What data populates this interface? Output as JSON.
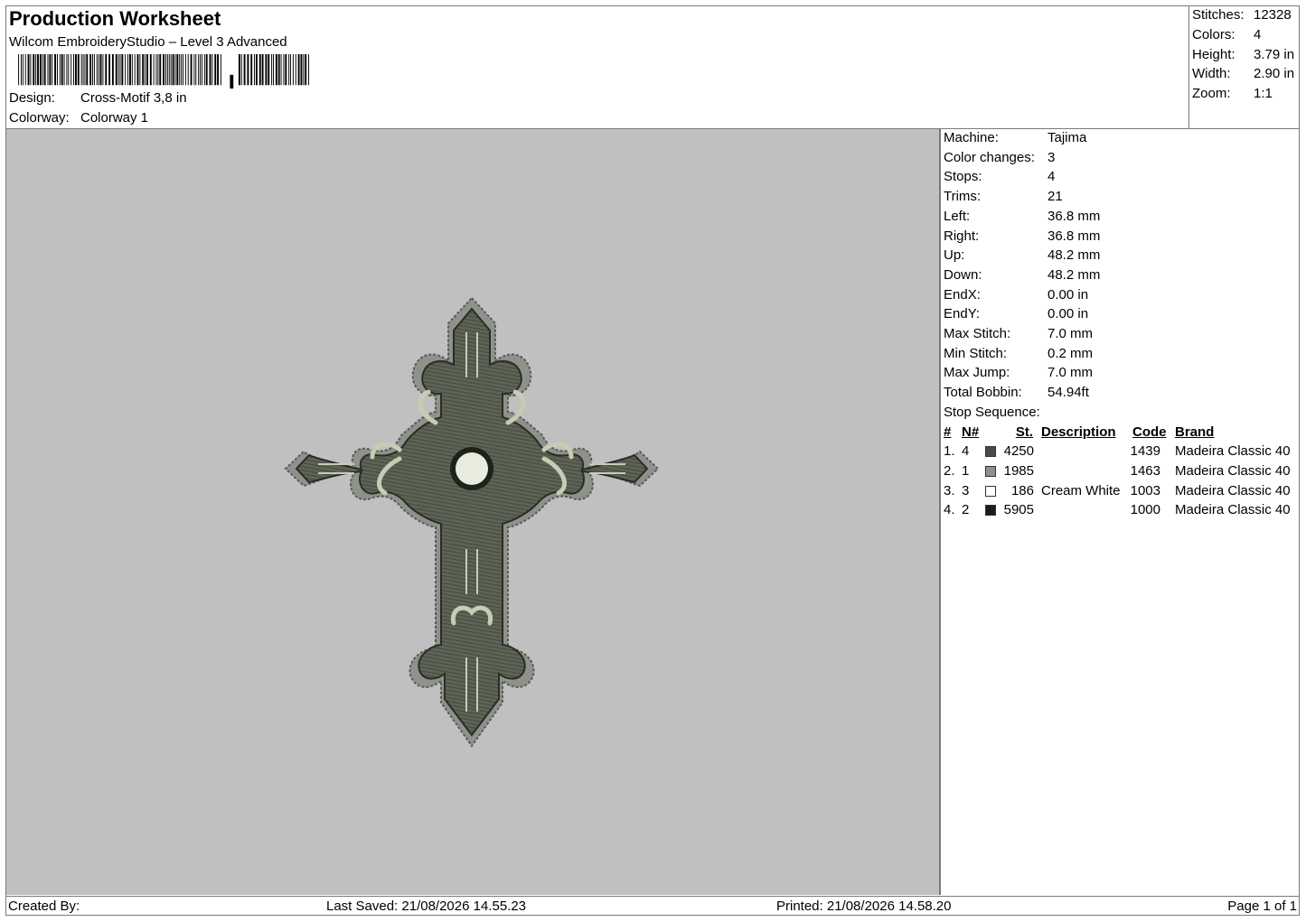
{
  "header": {
    "title": "Production Worksheet",
    "software": "Wilcom EmbroideryStudio – Level 3 Advanced",
    "design_label": "Design:",
    "design_value": "Cross-Motif 3,8 in",
    "colorway_label": "Colorway:",
    "colorway_value": "Colorway 1"
  },
  "stats": {
    "stitches_label": "Stitches:",
    "stitches_value": "12328",
    "colors_label": "Colors:",
    "colors_value": "4",
    "height_label": "Height:",
    "height_value": "3.79 in",
    "width_label": "Width:",
    "width_value": "2.90 in",
    "zoom_label": "Zoom:",
    "zoom_value": "1:1"
  },
  "machine_info": [
    {
      "label": "Machine:",
      "value": "Tajima"
    },
    {
      "label": "Color changes:",
      "value": "3"
    },
    {
      "label": "Stops:",
      "value": "4"
    },
    {
      "label": "Trims:",
      "value": "21"
    },
    {
      "label": "Left:",
      "value": "36.8 mm"
    },
    {
      "label": "Right:",
      "value": "36.8 mm"
    },
    {
      "label": "Up:",
      "value": "48.2 mm"
    },
    {
      "label": "Down:",
      "value": "48.2 mm"
    },
    {
      "label": "EndX:",
      "value": "0.00 in"
    },
    {
      "label": "EndY:",
      "value": "0.00 in"
    },
    {
      "label": "Max Stitch:",
      "value": "7.0 mm"
    },
    {
      "label": "Min Stitch:",
      "value": "0.2 mm"
    },
    {
      "label": "Max Jump:",
      "value": "7.0 mm"
    },
    {
      "label": "Total Bobbin:",
      "value": "54.94ft"
    }
  ],
  "stop_sequence_label": "Stop Sequence:",
  "table": {
    "headers": {
      "idx": "#",
      "n": "N#",
      "st": "St.",
      "desc": "Description",
      "code": "Code",
      "brand": "Brand"
    },
    "rows": [
      {
        "idx": "1.",
        "n": "4",
        "color": "#4a4a4a",
        "st": "4250",
        "desc": "",
        "code": "1439",
        "brand": "Madeira Classic 40"
      },
      {
        "idx": "2.",
        "n": "1",
        "color": "#8f9188",
        "st": "1985",
        "desc": "",
        "code": "1463",
        "brand": "Madeira Classic 40"
      },
      {
        "idx": "3.",
        "n": "3",
        "color": "#ffffff",
        "st": "186",
        "desc": "Cream White",
        "code": "1003",
        "brand": "Madeira Classic 40"
      },
      {
        "idx": "4.",
        "n": "2",
        "color": "#1c1c1c",
        "st": "5905",
        "desc": "",
        "code": "1000",
        "brand": "Madeira Classic 40"
      }
    ]
  },
  "footer": {
    "created_by": "Created By:",
    "last_saved": "Last Saved: 21/08/2026 14.55.23",
    "printed": "Printed: 21/08/2026 14.58.20",
    "page": "Page 1 of 1"
  }
}
